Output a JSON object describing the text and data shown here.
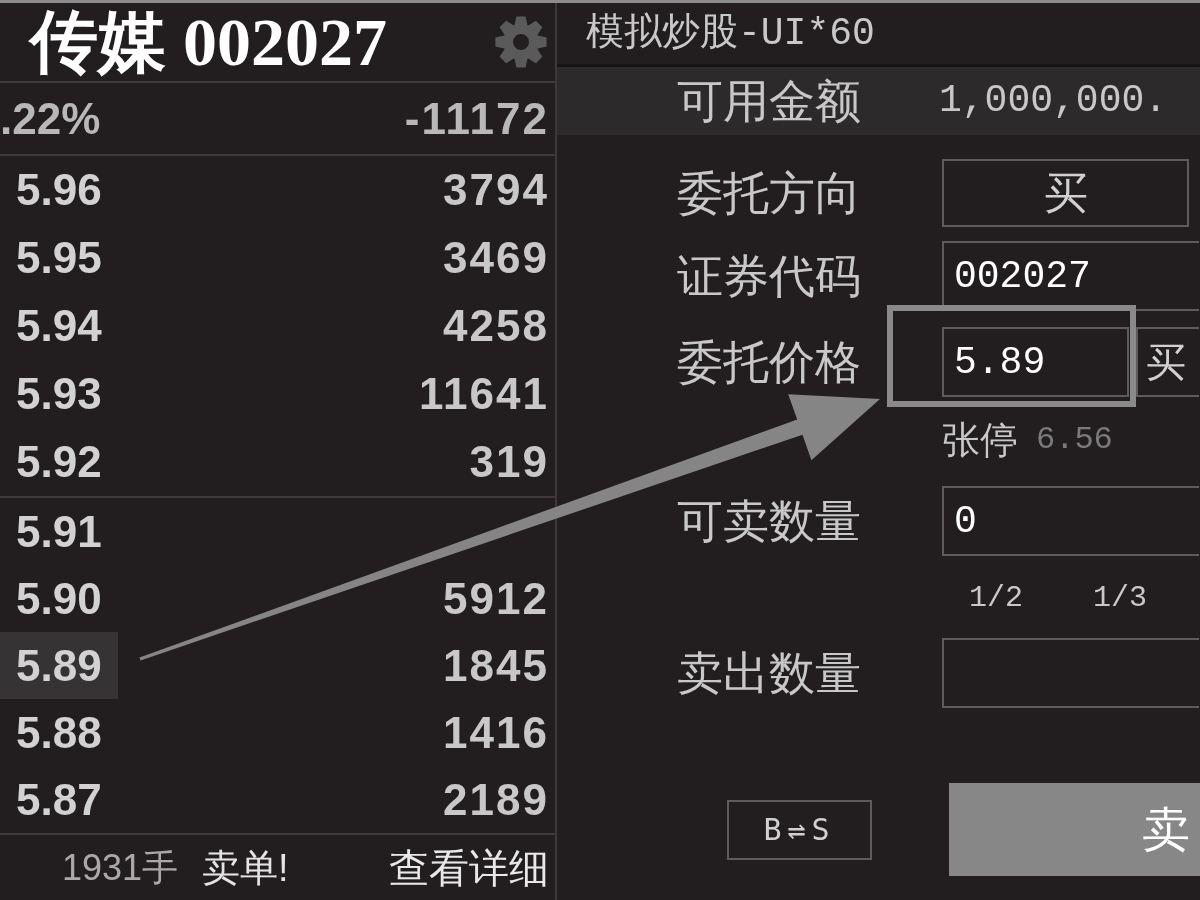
{
  "quote_panel": {
    "title": "传媒 002027",
    "change": ".22%",
    "net_volume": "-11172",
    "asks": [
      {
        "price": "5.96",
        "volume": "3794",
        "selected": false
      },
      {
        "price": "5.95",
        "volume": "3469",
        "selected": false
      },
      {
        "price": "5.94",
        "volume": "4258",
        "selected": false
      },
      {
        "price": "5.93",
        "volume": "11641",
        "selected": false
      },
      {
        "price": "5.92",
        "volume": "319",
        "selected": false
      }
    ],
    "bids": [
      {
        "price": "5.91",
        "selected": false
      },
      {
        "price": "5.90",
        "volume": "5912",
        "selected": false
      },
      {
        "price": "5.89",
        "volume": "1845",
        "selected": true
      },
      {
        "price": "5.88",
        "volume": "1416",
        "selected": false
      },
      {
        "price": "5.87",
        "volume": "2189",
        "selected": false
      }
    ],
    "footer": {
      "volume": "1931手",
      "label": "卖单!",
      "link": "查看详细"
    }
  },
  "trade_panel": {
    "title": "模拟炒股-UI*60",
    "funds": {
      "label": "可用金额",
      "value": "1,000,000."
    },
    "rows": [
      {
        "kind": "button",
        "label": "委托方向",
        "value": "买",
        "highlighted": false
      },
      {
        "kind": "input",
        "label": "证券代码",
        "value": "002027",
        "highlighted": false
      },
      {
        "kind": "price",
        "label": "委托价格",
        "value": "5.89",
        "side": "买",
        "highlighted": true
      },
      {
        "kind": "note",
        "label": "张停",
        "value": "6.56",
        "highlighted": false
      },
      {
        "kind": "input",
        "label": "可卖数量",
        "value": "0",
        "highlighted": false
      },
      {
        "kind": "fractions",
        "options": [
          "1/2",
          "1/3"
        ],
        "highlighted": false
      },
      {
        "kind": "input",
        "label": "卖出数量",
        "highlighted": false
      }
    ],
    "swap_button": "B⇌S",
    "submit_button": "卖"
  }
}
